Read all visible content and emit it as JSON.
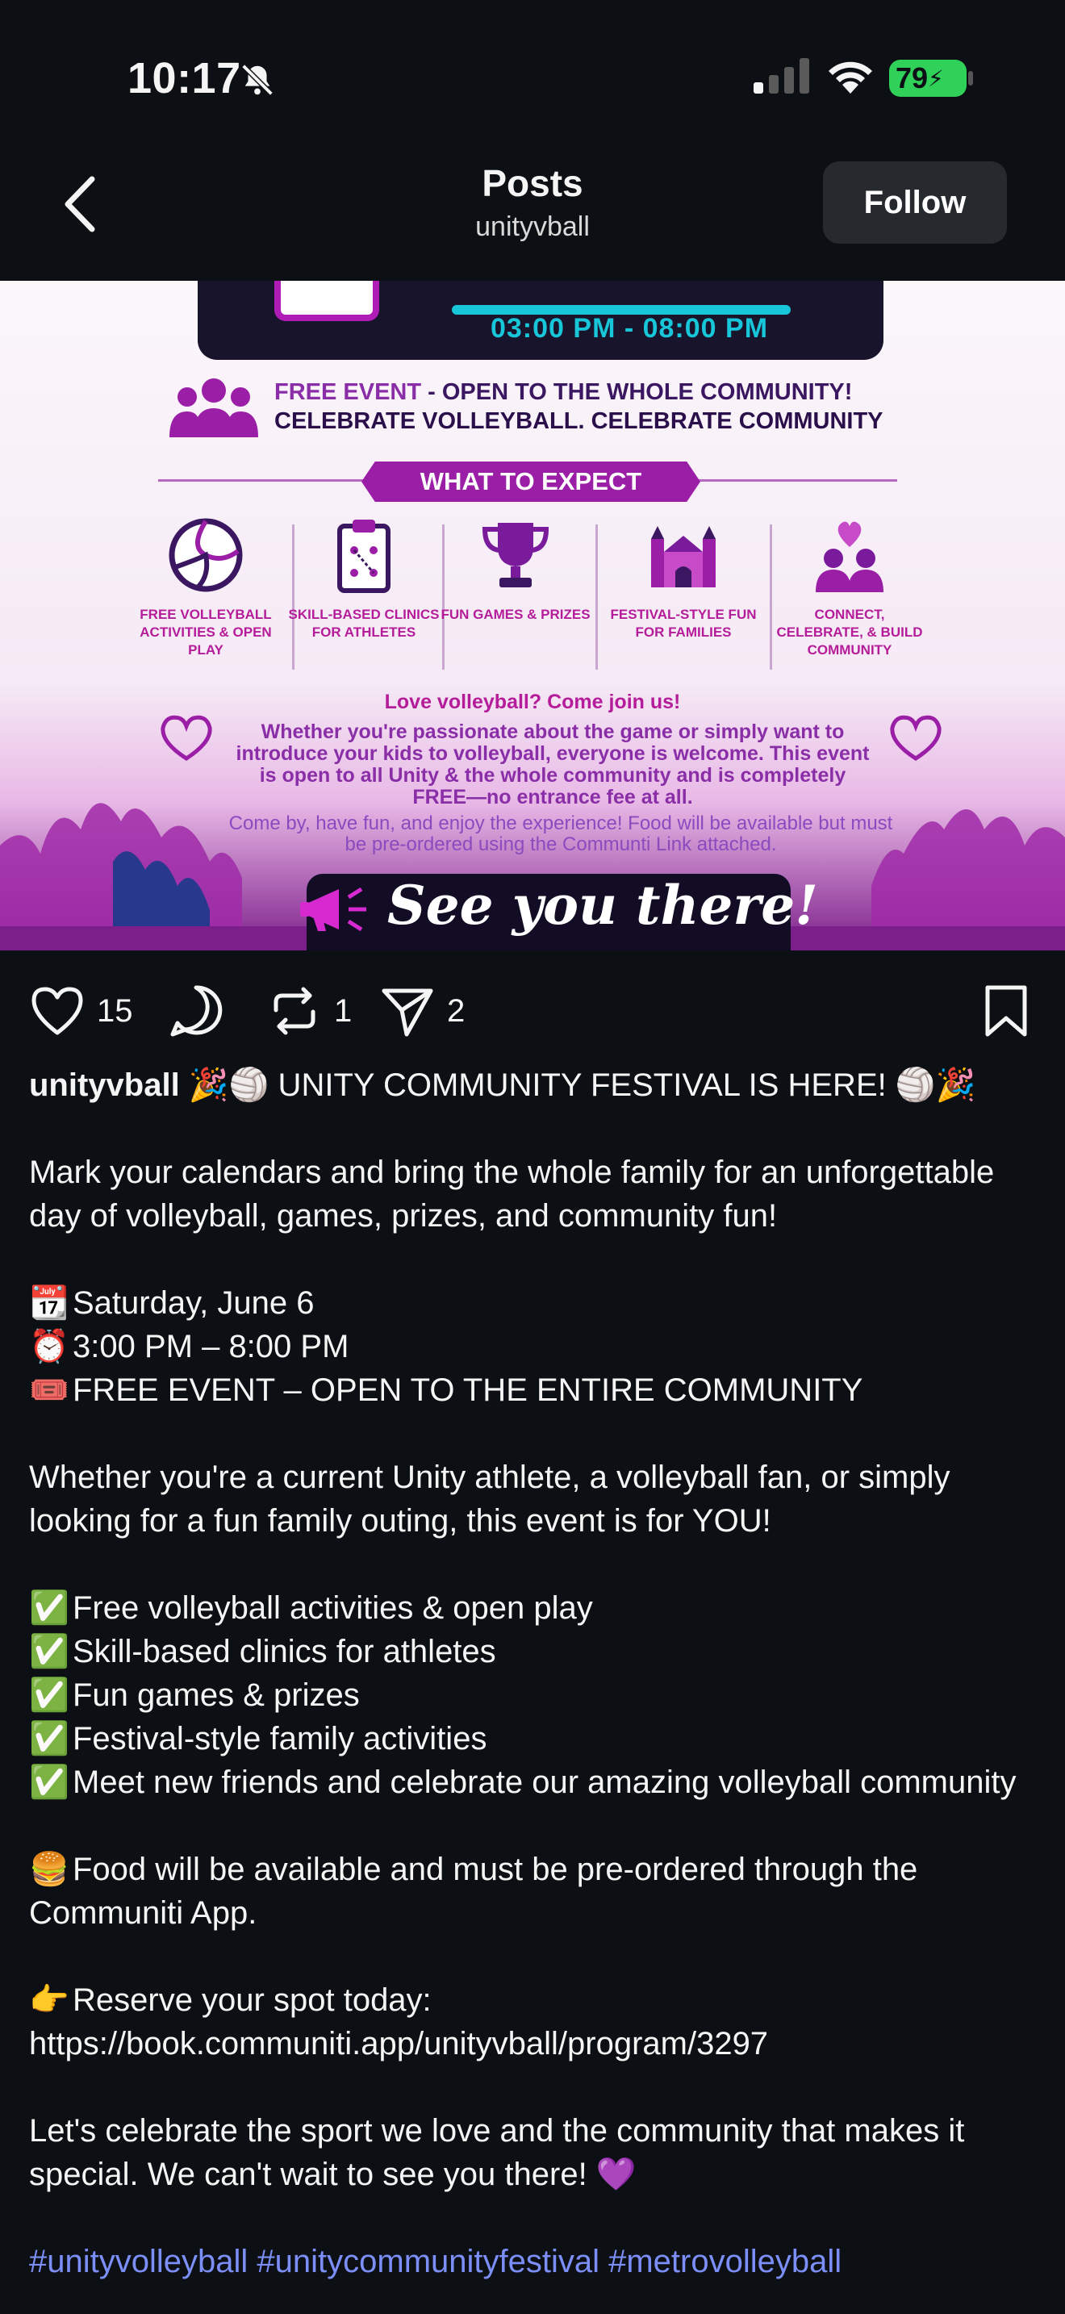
{
  "status_bar": {
    "time": "10:17",
    "battery": "79"
  },
  "header": {
    "title": "Posts",
    "subtitle": "unityvball",
    "follow_label": "Follow"
  },
  "post_image": {
    "time_range": "03:00 PM - 08:00 PM",
    "free_event_highlight": "FREE EVENT",
    "free_event_rest": " - OPEN TO THE WHOLE COMMUNITY!",
    "celebrate": "CELEBRATE VOLLEYBALL. CELEBRATE COMMUNITY",
    "banner": "WHAT TO EXPECT",
    "features": [
      {
        "label": "FREE VOLLEYBALL ACTIVITIES & OPEN PLAY",
        "icon": "volleyball-icon"
      },
      {
        "label": "SKILL-BASED CLINICS FOR ATHLETES",
        "icon": "clipboard-icon"
      },
      {
        "label": "FUN GAMES & PRIZES",
        "icon": "trophy-icon"
      },
      {
        "label": "FESTIVAL-STYLE FUN FOR FAMILIES",
        "icon": "bounce-house-icon"
      },
      {
        "label": "CONNECT, CELEBRATE, & BUILD COMMUNITY",
        "icon": "community-heart-icon"
      }
    ],
    "love_line": "Love volleyball? Come join us!",
    "paragraph": "Whether you're passionate about the game or simply want to introduce your kids to volleyball, everyone is welcome. This event is open to all Unity & the whole community and is completely FREE—no entrance fee at all.",
    "come_by": "Come by, have fun, and enjoy the experience! Food will be available but must be pre-ordered using the Communti Link attached.",
    "see_you": "See you there!"
  },
  "actions": {
    "likes": "15",
    "reposts": "1",
    "shares": "2"
  },
  "caption": {
    "username": "unityvball",
    "headline": "🎉🏐 UNITY COMMUNITY FESTIVAL IS HERE! 🏐🎉",
    "intro": "Mark your calendars and bring the whole family for an unforgettable day of volleyball, games, prizes, and community fun!",
    "date_emoji": "📆",
    "date": "Saturday, June 6",
    "time_emoji": "⏰",
    "time": "3:00 PM – 8:00 PM",
    "ticket_emoji": "🎟️",
    "free": "FREE EVENT – OPEN TO THE ENTIRE COMMUNITY",
    "whether": "Whether you're a current Unity athlete, a volleyball fan, or simply looking for a fun family outing, this event is for YOU!",
    "check_emoji": "✅",
    "list": [
      "Free volleyball activities & open play",
      "Skill-based clinics for athletes",
      "Fun games & prizes",
      "Festival-style family activities",
      "Meet new friends and celebrate our amazing volleyball community"
    ],
    "food_emoji": "🍔",
    "food": "Food will be available and must be pre-ordered through the Communiti App.",
    "point_emoji": "👉",
    "reserve": "Reserve your spot today:",
    "link": "https://book.communiti.app/unityvball/program/3297",
    "closing": "Let's celebrate the sport we love and the community that makes it special. We can't wait to see you there! 💜",
    "hashtags": "#unityvolleyball #unitycommunityfestival #metrovolleyball"
  },
  "colors": {
    "background": "#0c1014",
    "accent_purple": "#9a1ea6",
    "accent_cyan": "#18c6d9",
    "hashtag_blue": "#7c8ef8",
    "battery_green": "#30d158"
  }
}
